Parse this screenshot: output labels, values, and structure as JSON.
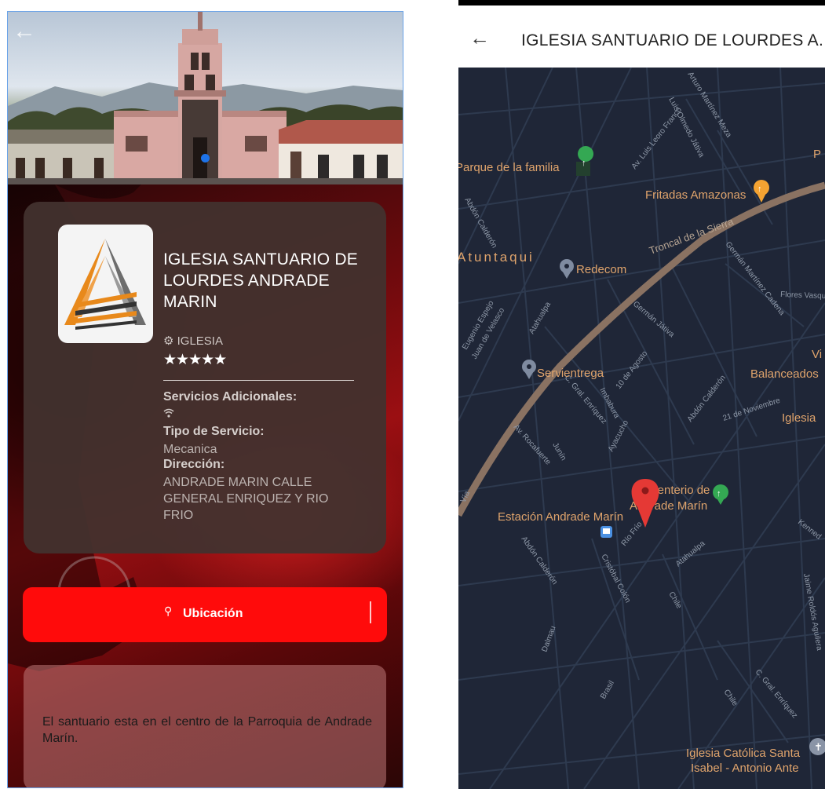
{
  "left_screen": {
    "hero": {
      "back_icon": "arrow-left-icon",
      "carousel_dots": 1
    },
    "card": {
      "title": "IGLESIA SANTUARIO DE LOURDES ANDRADE MARIN",
      "category_icon": "gear-icon",
      "category": "IGLESIA",
      "rating": 5,
      "stars": "★★★★★",
      "services_label": "Servicios Adicionales:",
      "services_icon": "wifi-icon",
      "service_type_label": "Tipo de Servicio:",
      "service_type": "Mecanica",
      "address_label": "Dirección:",
      "address": "ANDRADE MARIN CALLE GENERAL ENRIQUEZ Y RIO FRIO"
    },
    "location_button": {
      "label": "Ubicación",
      "icon": "pin-icon"
    },
    "description": "El santuario esta en el centro de la Parroquia de Andrade Marín."
  },
  "right_screen": {
    "back_icon": "arrow-left-icon",
    "title": "IGLESIA SANTUARIO DE LOURDES A...",
    "map": {
      "places": {
        "parque": "Parque de la familia",
        "fritadas": "Fritadas Amazonas",
        "atuntaqui": "Atuntaqui",
        "redecom": "Redecom",
        "servientrega": "Servientrega",
        "balanceados": "Balanceados",
        "iglesia_partial": "Iglesia",
        "vi_partial": "Vi",
        "p_partial": "P",
        "cementerio_1": "Cementerio de",
        "cementerio_2": "Andrade Marín",
        "estacion": "Estación Andrade Marín",
        "santa_isabel_1": "Iglesia Católica Santa",
        "santa_isabel_2": "Isabel - Antonio Ante"
      },
      "streets": {
        "troncal": "Troncal de la Sierra",
        "leoro": "Av. Luis Leoro Franco",
        "arturo": "Arturo Martínez Meza",
        "olmedo": "Luis Olmedo Játiva",
        "german_mc": "Germán Martínez Cadena",
        "flores": "Flores Vasquez",
        "german_j": "Germán Játiva",
        "espejo": "Eugenio Espejo",
        "velasco": "Juan de Velasco",
        "atahualpa1": "Atahualpa",
        "abdon1": "Abdón Calderón",
        "abdon2": "Abdón Calderón",
        "abdon3": "Abdón Calderón",
        "agosto": "10 de Agosto",
        "noviembre": "21 de Noviembre",
        "enriquez1": "C. Gral. Enríquez",
        "imbabura": "Imbabura",
        "ayacucho": "Ayacucho",
        "junin": "Junín",
        "rocafuerte": "Av. Rocafuerte",
        "riofrio": "Río Frío",
        "colon": "Cristóbal Colón",
        "atahualpa2": "Atahualpa",
        "chile1": "Chile",
        "chile2": "Chile",
        "dalmau": "Dalmau",
        "brasil": "Brasil",
        "enriquez2": "C. Gral. Enríquez",
        "jaime": "Jaime Roldós Aguilera",
        "kennedy": "Kenned",
        "via": "Vía"
      },
      "colors": {
        "background": "#1f2637",
        "road": "#2e3a4f",
        "highway": "#8a7262",
        "label": "#e0a46c",
        "street_label": "#8f99a8",
        "marker": "#e53935"
      }
    }
  }
}
